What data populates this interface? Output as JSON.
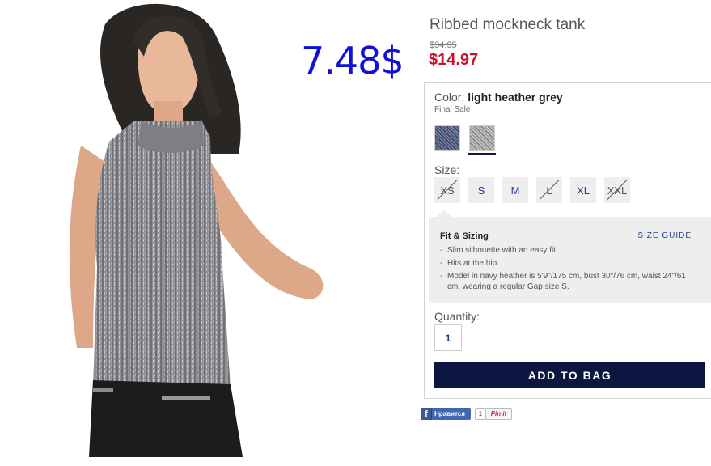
{
  "overlay": {
    "handwritten_price": "7.48$"
  },
  "product": {
    "title": "Ribbed mockneck tank",
    "original_price": "$34.95",
    "sale_price": "$14.97"
  },
  "color": {
    "label": "Color:",
    "selected": "light heather grey",
    "note": "Final Sale",
    "swatches": [
      "navy-heather",
      "light-heather-grey"
    ]
  },
  "sizes": {
    "label": "Size:",
    "options": [
      {
        "label": "XS",
        "available": false
      },
      {
        "label": "S",
        "available": true
      },
      {
        "label": "M",
        "available": true
      },
      {
        "label": "L",
        "available": false
      },
      {
        "label": "XL",
        "available": true
      },
      {
        "label": "XXL",
        "available": false
      }
    ]
  },
  "fit": {
    "title": "Fit & Sizing",
    "size_guide": "SIZE GUIDE",
    "items": [
      "Slim silhouette with an easy fit.",
      "Hits at the hip.",
      "Model in navy heather is 5'9\"/175 cm, bust 30\"/76 cm, waist 24\"/61 cm, wearing a regular Gap size S."
    ]
  },
  "quantity": {
    "label": "Quantity:",
    "value": "1"
  },
  "cart": {
    "add_label": "ADD TO BAG"
  },
  "social": {
    "like_label": "Нравится",
    "pin_count": "1",
    "pin_label": "Pin it"
  },
  "colors": {
    "sale": "#c8102e",
    "primary_button": "#0d1640",
    "link": "#1f3e8c",
    "overlay_text": "#1010d8"
  }
}
